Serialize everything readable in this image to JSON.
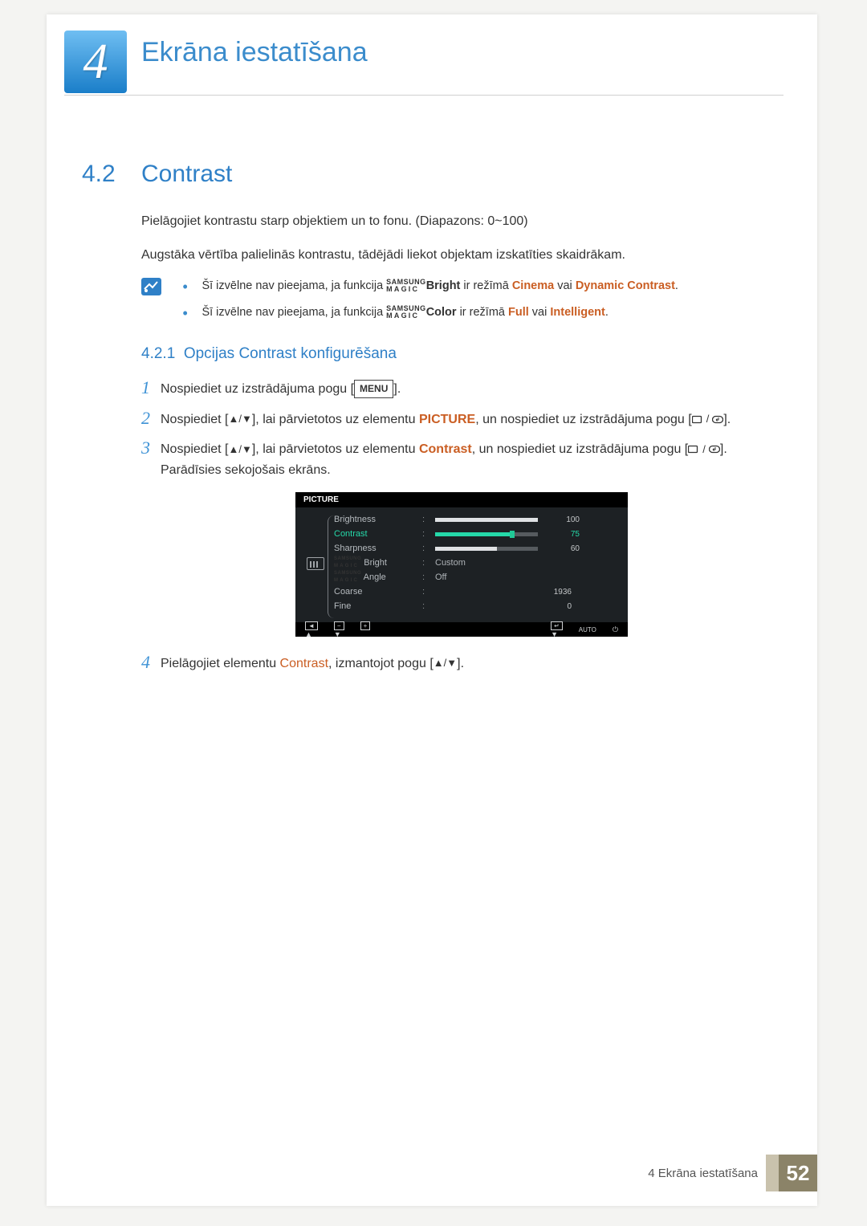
{
  "chapter": {
    "number": "4",
    "title": "Ekrāna iestatīšana"
  },
  "section": {
    "number": "4.2",
    "title": "Contrast"
  },
  "intro": {
    "p1": "Pielāgojiet kontrastu starp objektiem un to fonu. (Diapazons: 0~100)",
    "p2": "Augstāka vērtība palielinās kontrastu, tādējādi liekot objektam izskatīties skaidrākam."
  },
  "notes": {
    "n1_pre": "Šī izvēlne nav pieejama, ja funkcija ",
    "n1_suffix": "Bright",
    "n1_mid": " ir režīmā ",
    "n1_k1": "Cinema",
    "n1_or": " vai ",
    "n1_k2": "Dynamic Contrast",
    "n2_pre": "Šī izvēlne nav pieejama, ja funkcija ",
    "n2_suffix": "Color",
    "n2_mid": " ir režīmā ",
    "n2_k1": "Full",
    "n2_or": " vai ",
    "n2_k2": "Intelligent",
    "magic_top": "SAMSUNG",
    "magic_bot": "MAGIC"
  },
  "subsection": {
    "number": "4.2.1",
    "title": "Opcijas Contrast konfigurēšana"
  },
  "steps": {
    "s1_a": "Nospiediet uz izstrādājuma pogu [",
    "s1_menu": "MENU",
    "s1_b": "].",
    "s2_a": "Nospiediet [",
    "s2_b": "], lai pārvietotos uz elementu ",
    "s2_pic": "PICTURE",
    "s2_c": ", un nospiediet uz izstrādājuma pogu [",
    "s2_d": "].",
    "s3_a": "Nospiediet [",
    "s3_b": "], lai pārvietotos uz elementu ",
    "s3_con": "Contrast",
    "s3_c": ", un nospiediet uz izstrādājuma pogu [",
    "s3_d": "]. Parādīsies sekojošais ekrāns.",
    "s4_a": "Pielāgojiet elementu ",
    "s4_con": "Contrast",
    "s4_b": ", izmantojot pogu [",
    "s4_c": "]."
  },
  "osd": {
    "header": "PICTURE",
    "rows": [
      {
        "label": "Brightness",
        "type": "bar",
        "value": 100,
        "fill": 100,
        "selected": false
      },
      {
        "label": "Contrast",
        "type": "bar",
        "value": 75,
        "fill": 75,
        "selected": true
      },
      {
        "label": "Sharpness",
        "type": "bar",
        "value": 60,
        "fill": 60,
        "selected": false
      },
      {
        "label_top": "SAMSUNG",
        "label_bot": "MAGIC",
        "label_suffix": " Bright",
        "type": "text",
        "value": "Custom"
      },
      {
        "label_top": "SAMSUNG",
        "label_bot": "MAGIC",
        "label_suffix": " Angle",
        "type": "text",
        "value": "Off"
      },
      {
        "label": "Coarse",
        "type": "num",
        "value": 1936
      },
      {
        "label": "Fine",
        "type": "num",
        "value": 0
      }
    ],
    "footer_auto": "AUTO"
  },
  "footer": {
    "text": "4 Ekrāna iestatīšana",
    "page": "52"
  }
}
